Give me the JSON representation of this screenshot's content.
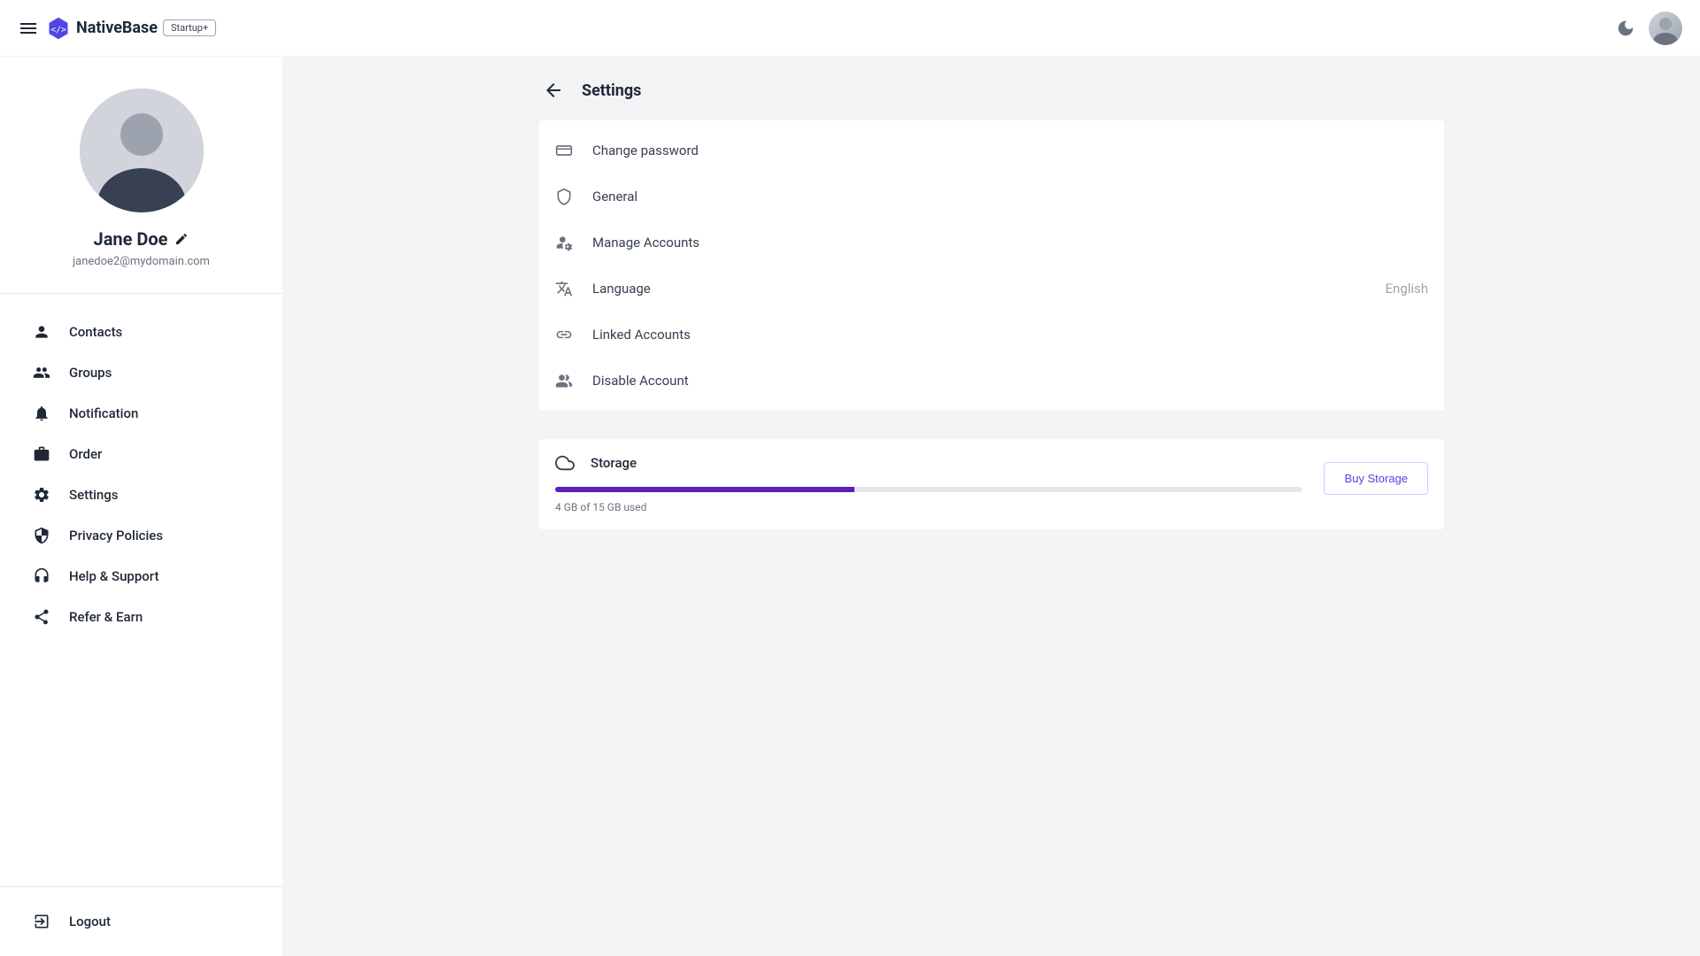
{
  "header": {
    "brand": "NativeBase",
    "badge": "Startup+"
  },
  "profile": {
    "name": "Jane Doe",
    "email": "janedoe2@mydomain.com"
  },
  "sidebar": {
    "items": [
      {
        "label": "Contacts",
        "icon": "person-icon"
      },
      {
        "label": "Groups",
        "icon": "groups-icon"
      },
      {
        "label": "Notification",
        "icon": "bell-icon"
      },
      {
        "label": "Order",
        "icon": "bag-icon"
      },
      {
        "label": "Settings",
        "icon": "gear-icon"
      },
      {
        "label": "Privacy Policies",
        "icon": "shield-icon"
      },
      {
        "label": "Help & Support",
        "icon": "support-icon"
      },
      {
        "label": "Refer & Earn",
        "icon": "share-icon"
      }
    ],
    "logout": "Logout"
  },
  "page": {
    "title": "Settings"
  },
  "settings": {
    "rows": [
      {
        "label": "Change password",
        "icon": "card-icon",
        "value": ""
      },
      {
        "label": "General",
        "icon": "shield-outline-icon",
        "value": ""
      },
      {
        "label": "Manage Accounts",
        "icon": "manage-accounts-icon",
        "value": ""
      },
      {
        "label": "Language",
        "icon": "translate-icon",
        "value": "English"
      },
      {
        "label": "Linked Accounts",
        "icon": "link-icon",
        "value": ""
      },
      {
        "label": "Disable Account",
        "icon": "person-off-icon",
        "value": ""
      }
    ]
  },
  "storage": {
    "title": "Storage",
    "used_text": "4 GB of 15 GB used",
    "percent": 40,
    "buy_label": "Buy Storage"
  },
  "colors": {
    "accent": "#5b21b6",
    "primary": "#4f46e5"
  }
}
